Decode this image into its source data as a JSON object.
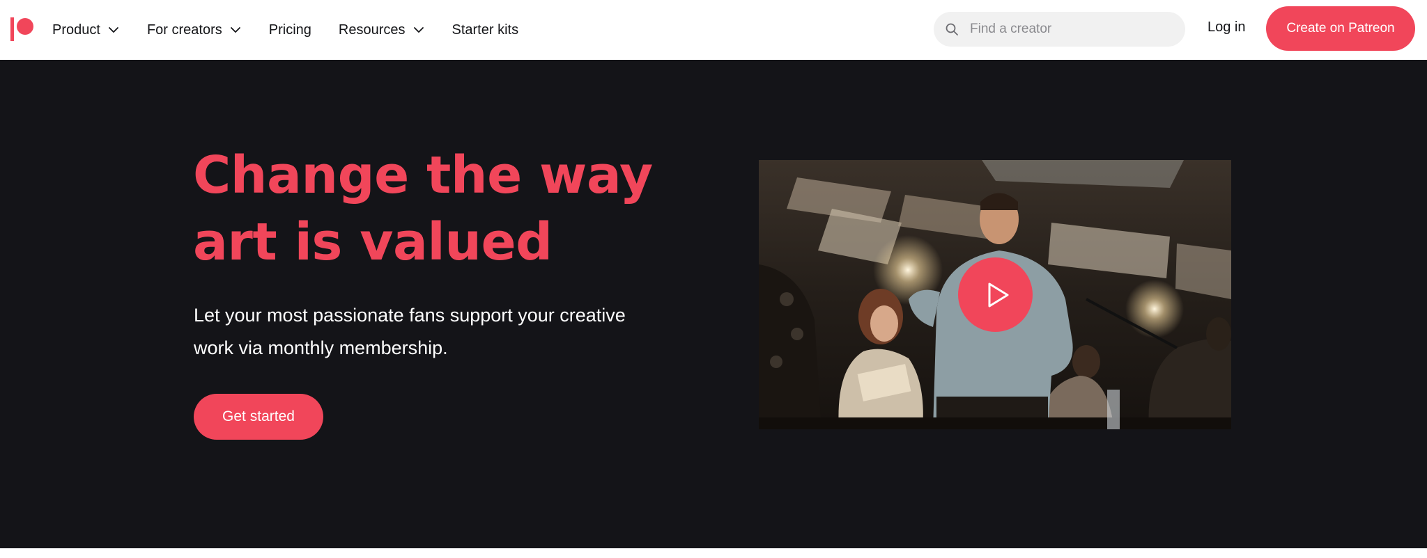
{
  "header": {
    "logo_icon": "patreon-logo",
    "nav": [
      {
        "label": "Product",
        "dropdown": true
      },
      {
        "label": "For creators",
        "dropdown": true
      },
      {
        "label": "Pricing",
        "dropdown": false
      },
      {
        "label": "Resources",
        "dropdown": true
      },
      {
        "label": "Starter kits",
        "dropdown": false
      }
    ],
    "search": {
      "placeholder": "Find a creator",
      "value": "",
      "icon": "search-icon"
    },
    "login_label": "Log in",
    "cta_label": "Create on Patreon"
  },
  "hero": {
    "title_line1": "Change the way",
    "title_line2": "art is valued",
    "subtitle_line1": "Let your most passionate fans support your creative",
    "subtitle_line2": "work via monthly membership.",
    "cta_label": "Get started",
    "video": {
      "play_icon": "play-icon"
    }
  },
  "colors": {
    "brand": "#f1465a",
    "hero_background": "#141418",
    "text_dark": "#141518",
    "search_background": "#f1f1f1"
  }
}
